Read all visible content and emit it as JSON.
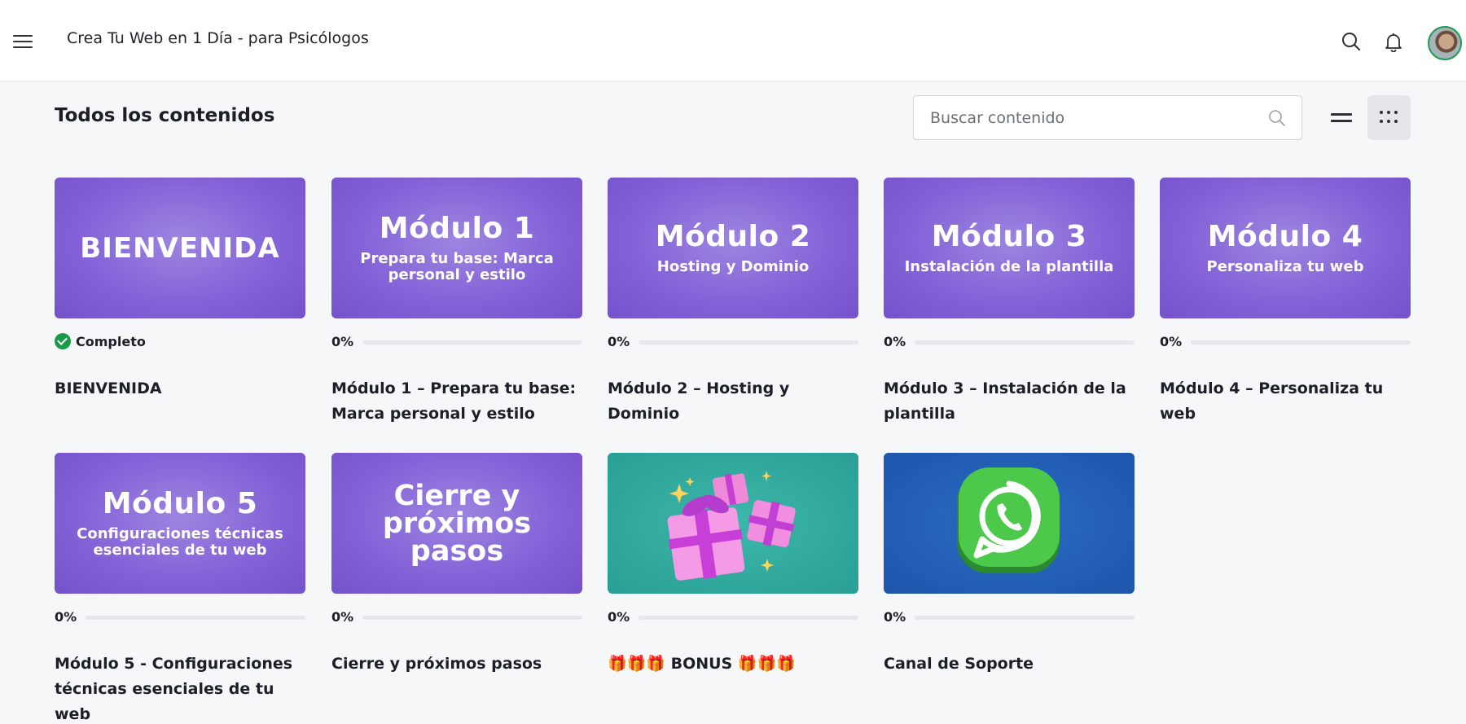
{
  "header": {
    "title": "Crea Tu Web en 1 Día - para Psicólogos",
    "menu_icon": "hamburger-menu-icon",
    "search_icon": "search-icon",
    "bell_icon": "bell-icon",
    "avatar": "user-avatar"
  },
  "toolbar": {
    "section_title": "Todos los contenidos",
    "search_placeholder": "Buscar contenido",
    "list_view_icon": "list-view-icon",
    "grid_view_icon": "grid-view-icon",
    "active_view": "grid"
  },
  "colors": {
    "accent_green": "#1a9b4b",
    "module_purple": "#8463d8",
    "bonus_teal": "#2a9e94",
    "support_blue": "#1e56ab"
  },
  "cards": [
    {
      "thumb_title": "BIENVENIDA",
      "thumb_sub": "",
      "status": "Completo",
      "progress": 100,
      "progress_label": "",
      "title": "BIENVENIDA"
    },
    {
      "thumb_title": "Módulo 1",
      "thumb_sub": "Prepara tu base: Marca personal y estilo",
      "status": "",
      "progress": 0,
      "progress_label": "0%",
      "title": "Módulo 1 – Prepara tu base: Marca personal y estilo"
    },
    {
      "thumb_title": "Módulo 2",
      "thumb_sub": "Hosting y Dominio",
      "status": "",
      "progress": 0,
      "progress_label": "0%",
      "title": "Módulo 2 – Hosting y Dominio"
    },
    {
      "thumb_title": "Módulo 3",
      "thumb_sub": "Instalación de la plantilla",
      "status": "",
      "progress": 0,
      "progress_label": "0%",
      "title": "Módulo 3 – Instalación de la plantilla"
    },
    {
      "thumb_title": "Módulo 4",
      "thumb_sub": "Personaliza tu web",
      "status": "",
      "progress": 0,
      "progress_label": "0%",
      "title": "Módulo 4 – Personaliza tu web"
    },
    {
      "thumb_title": "Módulo 5",
      "thumb_sub": "Configuraciones técnicas esenciales de tu web",
      "status": "",
      "progress": 0,
      "progress_label": "0%",
      "title": "Módulo 5 - Configuraciones técnicas esenciales de tu web"
    },
    {
      "thumb_title": "Cierre y próximos pasos",
      "thumb_sub": "",
      "status": "",
      "progress": 0,
      "progress_label": "0%",
      "title": "Cierre y próximos pasos"
    },
    {
      "thumb_icon": "gift-boxes-icon",
      "status": "",
      "progress": 0,
      "progress_label": "0%",
      "title": "🎁🎁🎁 BONUS 🎁🎁🎁"
    },
    {
      "thumb_icon": "whatsapp-icon",
      "status": "",
      "progress": 0,
      "progress_label": "0%",
      "title": "Canal de Soporte"
    }
  ]
}
